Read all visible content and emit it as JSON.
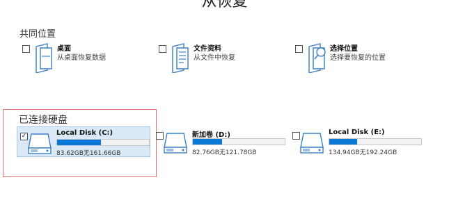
{
  "title": "从恢复",
  "common_locations": {
    "heading": "共同位置",
    "items": [
      {
        "name": "桌面",
        "desc": "从桌面恢复数据",
        "icon": "desktop-folder-icon"
      },
      {
        "name": "文件资料",
        "desc": "从文件中恢复",
        "icon": "documents-icon"
      },
      {
        "name": "选择位置",
        "desc": "选择要恢复的位置",
        "icon": "folder-search-icon"
      }
    ]
  },
  "connected_disks": {
    "heading": "已连接硬盘",
    "items": [
      {
        "name": "Local Disk (C:)",
        "space": "83.62GB无161.66GB",
        "used_fraction": 0.48,
        "checked": true,
        "check_mark": "✓"
      },
      {
        "name": "新加卷 (D:)",
        "space": "82.76GB无121.78GB",
        "used_fraction": 0.32,
        "checked": false,
        "check_mark": ""
      },
      {
        "name": "Local Disk (E:)",
        "space": "134.94GB无192.24GB",
        "used_fraction": 0.3,
        "checked": false,
        "check_mark": ""
      }
    ]
  },
  "colors": {
    "accent": "#0a78d7",
    "selected_bg": "#dbe9f6",
    "selection_frame": "#e57373"
  }
}
